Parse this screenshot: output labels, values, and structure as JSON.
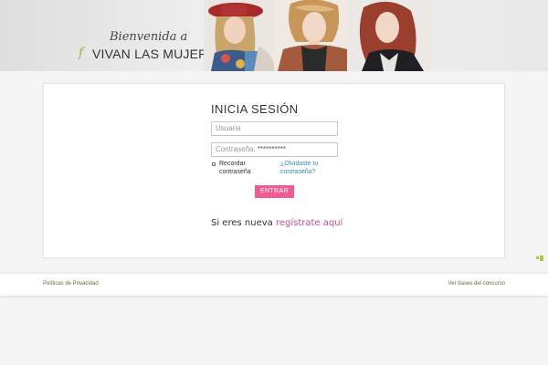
{
  "banner": {
    "welcome": "Bienvenida a",
    "tagline": "VIVAN LAS MUJERES",
    "logo_mark": "f"
  },
  "login": {
    "title": "INICIA SESIÓN",
    "username_placeholder": "Usuaria",
    "password_label": "Contraseña:",
    "password_value": "**********",
    "remember_label": "Recordar contraseña",
    "forgot_link": "¿Olvidaste tu contraseña?",
    "submit": "ENTRAR",
    "register_prefix": "Si eres nueva",
    "register_link": "regístrate aquí"
  },
  "footer": {
    "privacy": "Políticas de Privacidad",
    "contest": "Ver bases del concurso"
  },
  "colors": {
    "accent_pink": "#ef5b93",
    "link_blue": "#3a8bbb",
    "brand_green": "#98b84a"
  }
}
